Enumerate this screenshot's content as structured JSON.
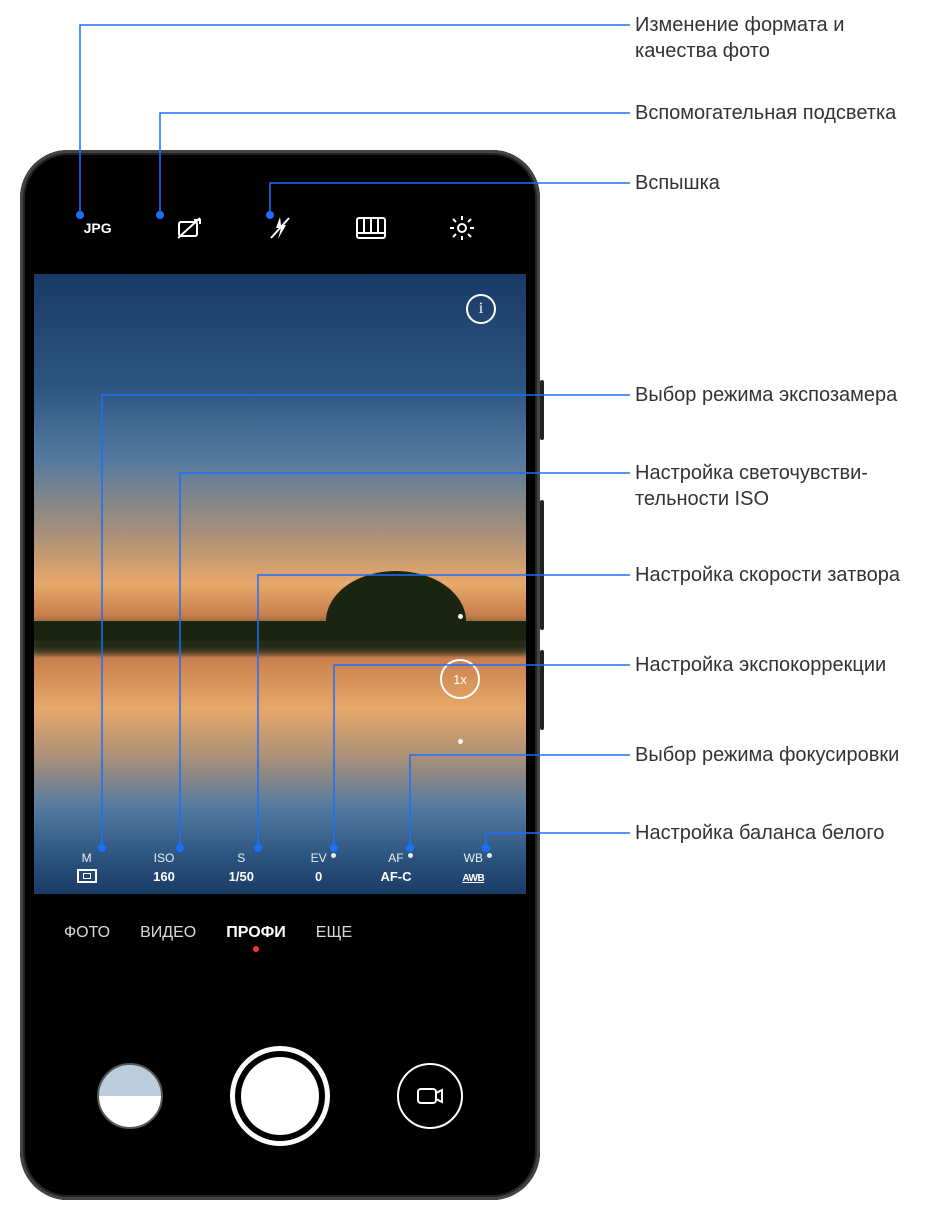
{
  "topbar": {
    "format_label": "JPG",
    "icons": {
      "format": "jpg-text",
      "aux_light": "aux-light-off-icon",
      "flash": "flash-off-icon",
      "filmstrip": "histogram-icon",
      "settings": "gear-icon"
    }
  },
  "viewfinder": {
    "info_glyph": "i",
    "zoom_label": "1x"
  },
  "pro": [
    {
      "label": "M",
      "value_icon": "metering",
      "dot": false
    },
    {
      "label": "ISO",
      "value": "160",
      "dot": false
    },
    {
      "label": "S",
      "value": "1/50",
      "dot": false
    },
    {
      "label": "EV",
      "value": "0",
      "dot": true
    },
    {
      "label": "AF",
      "value": "AF-C",
      "dot": true
    },
    {
      "label": "WB",
      "value_icon": "awb",
      "dot": true
    }
  ],
  "modes": [
    {
      "label": "ФОТО",
      "active": false
    },
    {
      "label": "ВИДЕО",
      "active": false
    },
    {
      "label": "ПРОФИ",
      "active": true
    },
    {
      "label": "ЕЩЕ",
      "active": false
    }
  ],
  "callouts": {
    "c1": "Изменение формата и качества фото",
    "c2": "Вспомогательная подсветка",
    "c3": "Вспышка",
    "c4": "Выбор режима экспозамера",
    "c5": "Настройка светочувстви­тельности ISO",
    "c6": "Настройка скорости затвора",
    "c7": "Настройка экспокоррекции",
    "c8": "Выбор режима фокусировки",
    "c9": "Настройка баланса белого"
  }
}
